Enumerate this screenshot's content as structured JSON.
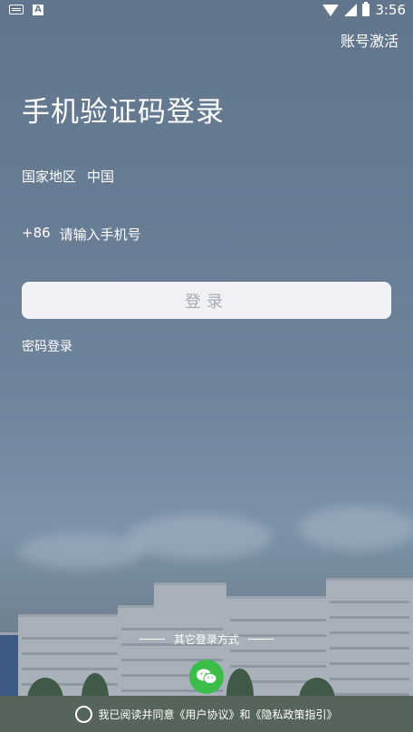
{
  "status_bar": {
    "time": "3:56",
    "left_icons": [
      "keyboard-icon",
      "a-icon"
    ],
    "right_icons": [
      "wifi-icon",
      "signal-icon",
      "battery-icon"
    ]
  },
  "header": {
    "activate_label": "账号激活"
  },
  "main": {
    "title": "手机验证码登录",
    "region_label": "国家地区",
    "region_value": "中国",
    "country_code": "+86",
    "phone_placeholder": "请输入手机号",
    "login_button": "登录",
    "password_login": "密码登录"
  },
  "footer": {
    "other_methods_label": "其它登录方式",
    "wechat_icon": "wechat-icon",
    "agreement_text": "我已阅读并同意《用户协议》和《隐私政策指引》"
  },
  "colors": {
    "login_button_bg": "#eff1f5",
    "login_button_text": "#a8acb3",
    "wechat_green": "#3cbd4a"
  }
}
